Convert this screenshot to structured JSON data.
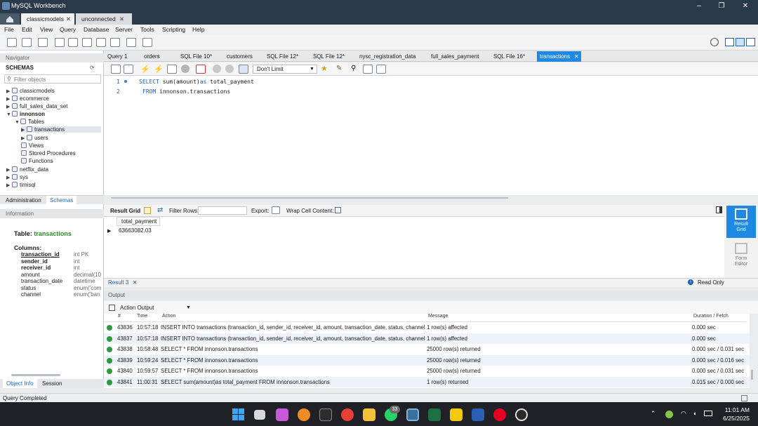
{
  "window": {
    "title": "MySQL Workbench"
  },
  "conn_tabs": [
    "classicmodels",
    "unconnected"
  ],
  "menu": [
    "File",
    "Edit",
    "View",
    "Query",
    "Database",
    "Server",
    "Tools",
    "Scripting",
    "Help"
  ],
  "navigator": {
    "header": "Navigator",
    "schemas_label": "SCHEMAS",
    "filter_placeholder": "Filter objects",
    "schemas": [
      "classicmodels",
      "ecommerce",
      "full_sales_data_set",
      "innonson",
      "netflix_data",
      "sys",
      "timisql"
    ],
    "tables_label": "Tables",
    "tables": [
      "transactions",
      "users"
    ],
    "views": "Views",
    "procs": "Stored Procedures",
    "funcs": "Functions",
    "tab_admin": "Administration",
    "tab_schemas": "Schemas"
  },
  "information": {
    "header": "Information",
    "table_prefix": "Table:",
    "table_name": "transactions",
    "columns_label": "Columns:",
    "columns": [
      [
        "transaction_id",
        "int PK"
      ],
      [
        "sender_id",
        "int"
      ],
      [
        "receiver_id",
        "int"
      ],
      [
        "amount",
        "decimal(10"
      ],
      [
        "transaction_date",
        "datetime"
      ],
      [
        "status",
        "enum('com"
      ],
      [
        "channel",
        "enum('ban"
      ]
    ],
    "tab_objinfo": "Object Info",
    "tab_session": "Session"
  },
  "doc_tabs": [
    "Query 1",
    "orders",
    "SQL File 10*",
    "customers",
    "SQL File 12*",
    "SQL File 12*",
    "nysc_registration_data",
    "full_sales_payment",
    "SQL File 16*",
    "transactions"
  ],
  "limit_select": "Don't Limit",
  "editor": {
    "line1_no": "1",
    "line2_no": "2",
    "l1_kw1": "SELECT",
    "l1_rest": " sum(amount)",
    "l1_kw2": "as",
    "l1_tail": " total_payment",
    "l2_kw": "FROM",
    "l2_tail": " innonson.transactions"
  },
  "result_bar": {
    "grid_label": "Result Grid",
    "filter_label": "Filter Rows:",
    "export_label": "Export:",
    "wrap_label": "Wrap Cell Content:"
  },
  "result": {
    "column": "total_payment",
    "value": "63663082.03"
  },
  "side_panel": {
    "grid": "Result Grid",
    "form": "Form Editor"
  },
  "result_tab": "Result 3",
  "read_only": "Read Only",
  "output": {
    "header": "Output",
    "mode": "Action Output",
    "columns": [
      "#",
      "Time",
      "Action",
      "Message",
      "Duration / Fetch"
    ],
    "rows": [
      [
        "43836",
        "10:57:18",
        "INSERT INTO transactions (transaction_id, sender_id, receiver_id, amount, transaction_date, status, channel) ...",
        "1 row(s) affected",
        "0.000 sec"
      ],
      [
        "43837",
        "10:57:18",
        "INSERT INTO transactions (transaction_id, sender_id, receiver_id, amount, transaction_date, status, channel) ...",
        "1 row(s) affected",
        "0.000 sec"
      ],
      [
        "43838",
        "10:58:48",
        "SELECT * FROM innonson.transactions",
        "25000 row(s) returned",
        "0.000 sec / 0.031 sec"
      ],
      [
        "43839",
        "10:59:24",
        "SELECT * FROM innonson.transactions",
        "25000 row(s) returned",
        "0.000 sec / 0.016 sec"
      ],
      [
        "43840",
        "10:59:57",
        "SELECT *  FROM innonson.transactions",
        "25000 row(s) returned",
        "0.000 sec / 0.031 sec"
      ],
      [
        "43841",
        "11:00:31",
        "SELECT sum(amount)as total_payment  FROM innonson.transactions",
        "1 row(s) returned",
        "0.015 sec / 0.000 sec"
      ]
    ]
  },
  "status": "Query Completed",
  "taskbar": {
    "time": "11:01 AM",
    "date": "6/25/2025",
    "badge": "33"
  },
  "colors": {
    "accent": "#1e88e5",
    "ok": "#2e9a3d",
    "titlebar": "#2b3a4a"
  }
}
